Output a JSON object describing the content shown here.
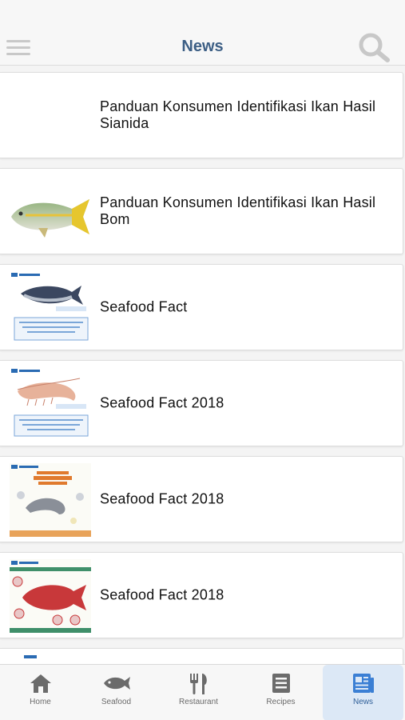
{
  "header": {
    "title": "News",
    "menu_icon": "hamburger-menu-icon",
    "search_icon": "search-icon"
  },
  "news": [
    {
      "title": "Panduan Konsumen Identifikasi Ikan Hasil Sianida",
      "thumbnail": "none"
    },
    {
      "title": "Panduan Konsumen Identifikasi Ikan Hasil Bom",
      "thumbnail": "yellowtail-fish-photo"
    },
    {
      "title": "Seafood Fact",
      "thumbnail": "seafood-savers-tuna-card"
    },
    {
      "title": "Seafood Fact 2018",
      "thumbnail": "seafood-savers-shrimp-card"
    },
    {
      "title": "Seafood Fact 2018",
      "thumbnail": "seafood-savers-udang-infographic"
    },
    {
      "title": "Seafood Fact 2018",
      "thumbnail": "seafood-savers-red-fish-infographic"
    }
  ],
  "tabs": [
    {
      "label": "Home",
      "icon": "home-icon"
    },
    {
      "label": "Seafood",
      "icon": "fish-icon"
    },
    {
      "label": "Restaurant",
      "icon": "fork-knife-icon"
    },
    {
      "label": "Recipes",
      "icon": "recipes-icon"
    },
    {
      "label": "News",
      "icon": "news-icon",
      "active": true
    }
  ],
  "colors": {
    "title": "#3d5f85",
    "active_tab_bg": "#dce8f6",
    "active_tab_icon": "#3b7fd4"
  }
}
